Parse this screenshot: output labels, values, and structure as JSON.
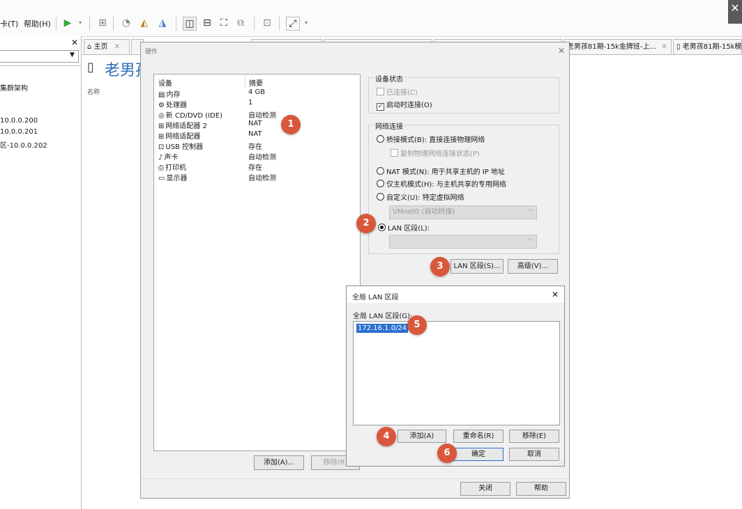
{
  "window": {
    "close_glyph": "✕"
  },
  "menubar": {
    "items": [
      "卡(T)",
      "帮助(H)"
    ]
  },
  "left_panel": {
    "close_glyph": "✕",
    "tree": [
      "集群架构",
      "10.0.0.200",
      "10.0.0.201",
      "区-10.0.0.202"
    ]
  },
  "tabs": [
    {
      "label": "主页",
      "close": "✕"
    },
    {
      "label": ""
    },
    {
      "label": ""
    },
    {
      "label": ""
    },
    {
      "label": ""
    },
    {
      "label": "老男孩81期-15k金牌班-上...",
      "close": "✕"
    },
    {
      "label": "老男孩81期-15k模"
    }
  ],
  "page": {
    "title": "老男孩",
    "name_column": "名称"
  },
  "hardware_dialog": {
    "title": "硬件",
    "close_glyph": "✕",
    "device_list": {
      "col_device": "设备",
      "col_summary": "摘要",
      "rows": [
        {
          "icon": "memory-icon",
          "glyph": "▤",
          "name": "内存",
          "summary": "4 GB"
        },
        {
          "icon": "cpu-icon",
          "glyph": "⚙",
          "name": "处理器",
          "summary": "1"
        },
        {
          "icon": "disc-icon",
          "glyph": "◎",
          "name": "新 CD/DVD (IDE)",
          "summary": "自动检测"
        },
        {
          "icon": "network-icon",
          "glyph": "⊞",
          "name": "网络适配器 2",
          "summary": "NAT"
        },
        {
          "icon": "network-icon",
          "glyph": "⊞",
          "name": "网络适配器",
          "summary": "NAT"
        },
        {
          "icon": "usb-icon",
          "glyph": "⊡",
          "name": "USB 控制器",
          "summary": "存在"
        },
        {
          "icon": "sound-icon",
          "glyph": "♪",
          "name": "声卡",
          "summary": "自动检测"
        },
        {
          "icon": "printer-icon",
          "glyph": "⎙",
          "name": "打印机",
          "summary": "存在"
        },
        {
          "icon": "display-icon",
          "glyph": "▭",
          "name": "显示器",
          "summary": "自动检测"
        }
      ]
    },
    "add_button": "添加(A)...",
    "remove_button": "移除(R)",
    "device_status": {
      "label": "设备状态",
      "connected": "已连接(C)",
      "connect_on_start": "启动时连接(O)"
    },
    "network_connection": {
      "label": "网络连接",
      "bridged": "桥接模式(B): 直接连接物理网络",
      "replicate": "复制物理网络连接状态(P)",
      "nat": "NAT 模式(N): 用于共享主机的 IP 地址",
      "host_only": "仅主机模式(H): 与主机共享的专用网络",
      "custom": "自定义(U): 特定虚拟网络",
      "custom_select": "VMnet0 (自动桥接)",
      "lan_segment": "LAN 区段(L):",
      "lan_select": ""
    },
    "lan_segments_button": "LAN 区段(S)...",
    "advanced_button": "高级(V)...",
    "close_button": "关闭",
    "help_button": "帮助"
  },
  "lan_dialog": {
    "title": "全局 LAN 区段",
    "close_glyph": "✕",
    "list_label": "全局 LAN 区段(G):",
    "segments": [
      "172.16.1.0/24"
    ],
    "add_button": "添加(A)",
    "rename_button": "重命名(R)",
    "remove_button": "移除(E)",
    "ok_button": "确定",
    "cancel_button": "取消"
  },
  "badges": [
    "1",
    "2",
    "3",
    "4",
    "5",
    "6"
  ],
  "colors": {
    "badge": "#d9573b",
    "accent": "#2b6fba",
    "selection": "#2a6fd1"
  }
}
